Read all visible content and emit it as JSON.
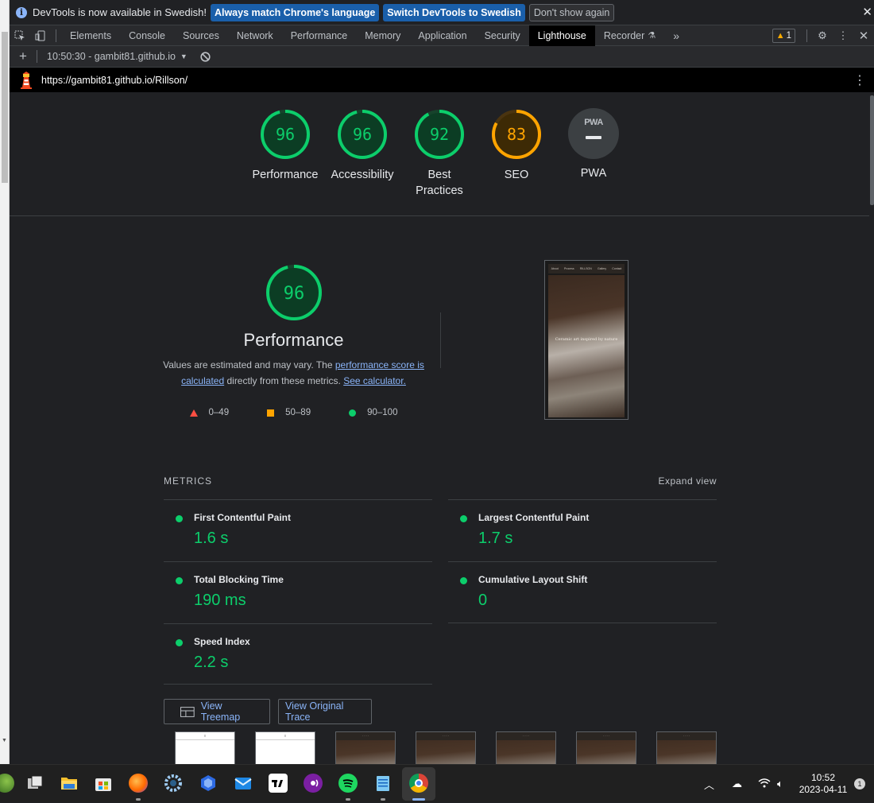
{
  "infobar": {
    "message": "DevTools is now available in Swedish!",
    "btn_match": "Always match Chrome's language",
    "btn_switch": "Switch DevTools to Swedish",
    "btn_dismiss": "Don't show again"
  },
  "tabs": [
    "Elements",
    "Console",
    "Sources",
    "Network",
    "Performance",
    "Memory",
    "Application",
    "Security",
    "Lighthouse",
    "Recorder"
  ],
  "active_tab": "Lighthouse",
  "warning_count": "1",
  "report_selector": "10:50:30 - gambit81.github.io",
  "url": "https://gambit81.github.io/Rillson/",
  "gauges": [
    {
      "score": 96,
      "label": "Performance",
      "color": "#0cce6b"
    },
    {
      "score": 96,
      "label": "Accessibility",
      "color": "#0cce6b"
    },
    {
      "score": 92,
      "label": "Best Practices",
      "color": "#0cce6b"
    },
    {
      "score": 83,
      "label": "SEO",
      "color": "#ffa400"
    }
  ],
  "pwa": {
    "badge": "PWA",
    "label": "PWA"
  },
  "performance": {
    "score": "96",
    "title": "Performance",
    "desc_1": "Values are estimated and may vary. The ",
    "link_1": "performance score is calculated",
    "desc_2": " directly from these metrics. ",
    "link_2": "See calculator.",
    "legend": {
      "fail": "0–49",
      "average": "50–89",
      "pass": "90–100"
    }
  },
  "screenshot": {
    "nav": [
      "About",
      "Process",
      "RILLSON",
      "Gallery",
      "Contact"
    ],
    "headline": "Ceramic art inspired by nature"
  },
  "metrics": {
    "heading": "METRICS",
    "expand": "Expand view",
    "items": [
      {
        "name": "First Contentful Paint",
        "value": "1.6 s"
      },
      {
        "name": "Largest Contentful Paint",
        "value": "1.7 s"
      },
      {
        "name": "Total Blocking Time",
        "value": "190 ms"
      },
      {
        "name": "Cumulative Layout Shift",
        "value": "0"
      },
      {
        "name": "Speed Index",
        "value": "2.2 s"
      }
    ]
  },
  "buttons": {
    "treemap": "View Treemap",
    "trace": "View Original Trace"
  },
  "taskbar": {
    "time": "10:52",
    "date": "2023-04-11",
    "notifications": "1"
  },
  "colors": {
    "pass": "#0cce6b",
    "average": "#ffa400",
    "fail": "#ff4e42",
    "link": "#8ab4f8"
  }
}
